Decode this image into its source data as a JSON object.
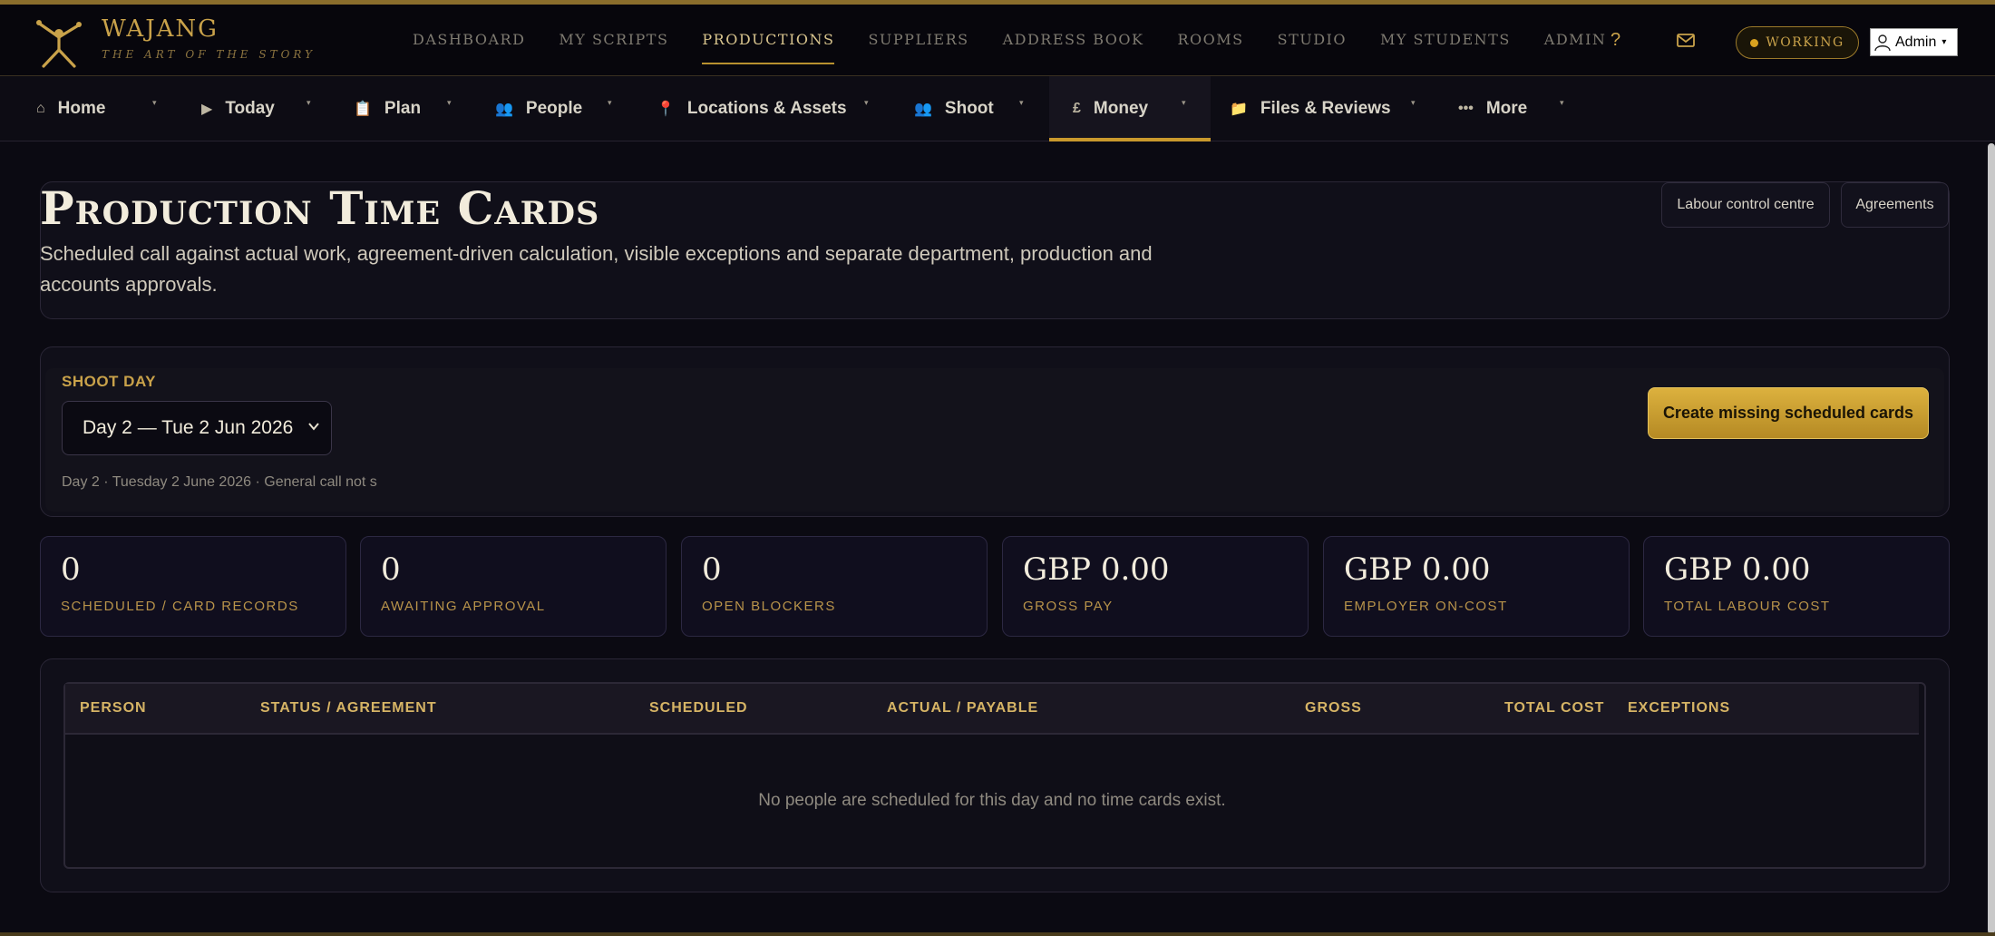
{
  "brand": {
    "name": "WAJANG",
    "tagline": "THE ART OF THE STORY"
  },
  "topnav": [
    {
      "label": "DASHBOARD",
      "active": false
    },
    {
      "label": "MY SCRIPTS",
      "active": false
    },
    {
      "label": "PRODUCTIONS",
      "active": true
    },
    {
      "label": "SUPPLIERS",
      "active": false
    },
    {
      "label": "ADDRESS BOOK",
      "active": false
    },
    {
      "label": "ROOMS",
      "active": false
    },
    {
      "label": "STUDIO",
      "active": false
    },
    {
      "label": "MY STUDENTS",
      "active": false
    },
    {
      "label": "ADMIN",
      "active": false
    }
  ],
  "topbar": {
    "help": "?",
    "working_label": "WORKING",
    "admin_label": "Admin",
    "admin_caret": "▾"
  },
  "subnav": [
    {
      "label": "Home",
      "icon": "home-icon",
      "glyph": "⌂"
    },
    {
      "label": "Today",
      "icon": "play-icon",
      "glyph": "▶"
    },
    {
      "label": "Plan",
      "icon": "clipboard-icon",
      "glyph": "📋"
    },
    {
      "label": "People",
      "icon": "people-icon",
      "glyph": "👥"
    },
    {
      "label": "Locations & Assets",
      "icon": "pin-icon",
      "glyph": "📍"
    },
    {
      "label": "Shoot",
      "icon": "crew-icon",
      "glyph": "👥"
    },
    {
      "label": "Money",
      "icon": "pound-icon",
      "glyph": "£",
      "active": true
    },
    {
      "label": "Files & Reviews",
      "icon": "folder-icon",
      "glyph": "📁"
    },
    {
      "label": "More",
      "icon": "more-icon",
      "glyph": "•••"
    }
  ],
  "subnav_caret": "▾",
  "page": {
    "title": "Production Time Cards",
    "description": "Scheduled call against actual work, agreement-driven calculation, visible exceptions and separate department, production and accounts approvals.",
    "buttons": {
      "labour_control": "Labour control centre",
      "agreements": "Agreements"
    }
  },
  "shoot_day": {
    "label": "SHOOT DAY",
    "selected": "Day 2 — Tue 2 Jun 2026",
    "summary": "Day 2 · Tuesday 2 June 2026 · General call not s",
    "create_button": "Create missing scheduled cards"
  },
  "stats": [
    {
      "value": "0",
      "label": "SCHEDULED / CARD RECORDS"
    },
    {
      "value": "0",
      "label": "AWAITING APPROVAL"
    },
    {
      "value": "0",
      "label": "OPEN BLOCKERS"
    },
    {
      "value": "GBP 0.00",
      "label": "GROSS PAY"
    },
    {
      "value": "GBP 0.00",
      "label": "EMPLOYER ON-COST"
    },
    {
      "value": "GBP 0.00",
      "label": "TOTAL LABOUR COST"
    }
  ],
  "table": {
    "columns": [
      "PERSON",
      "STATUS / AGREEMENT",
      "SCHEDULED",
      "ACTUAL / PAYABLE",
      "GROSS",
      "TOTAL COST",
      "EXCEPTIONS"
    ],
    "empty_message": "No people are scheduled for this day and no time cards exist."
  },
  "colors": {
    "accent_gold": "#c9a24a",
    "button_gold": "#dcb13e",
    "background": "#0b0a12"
  }
}
